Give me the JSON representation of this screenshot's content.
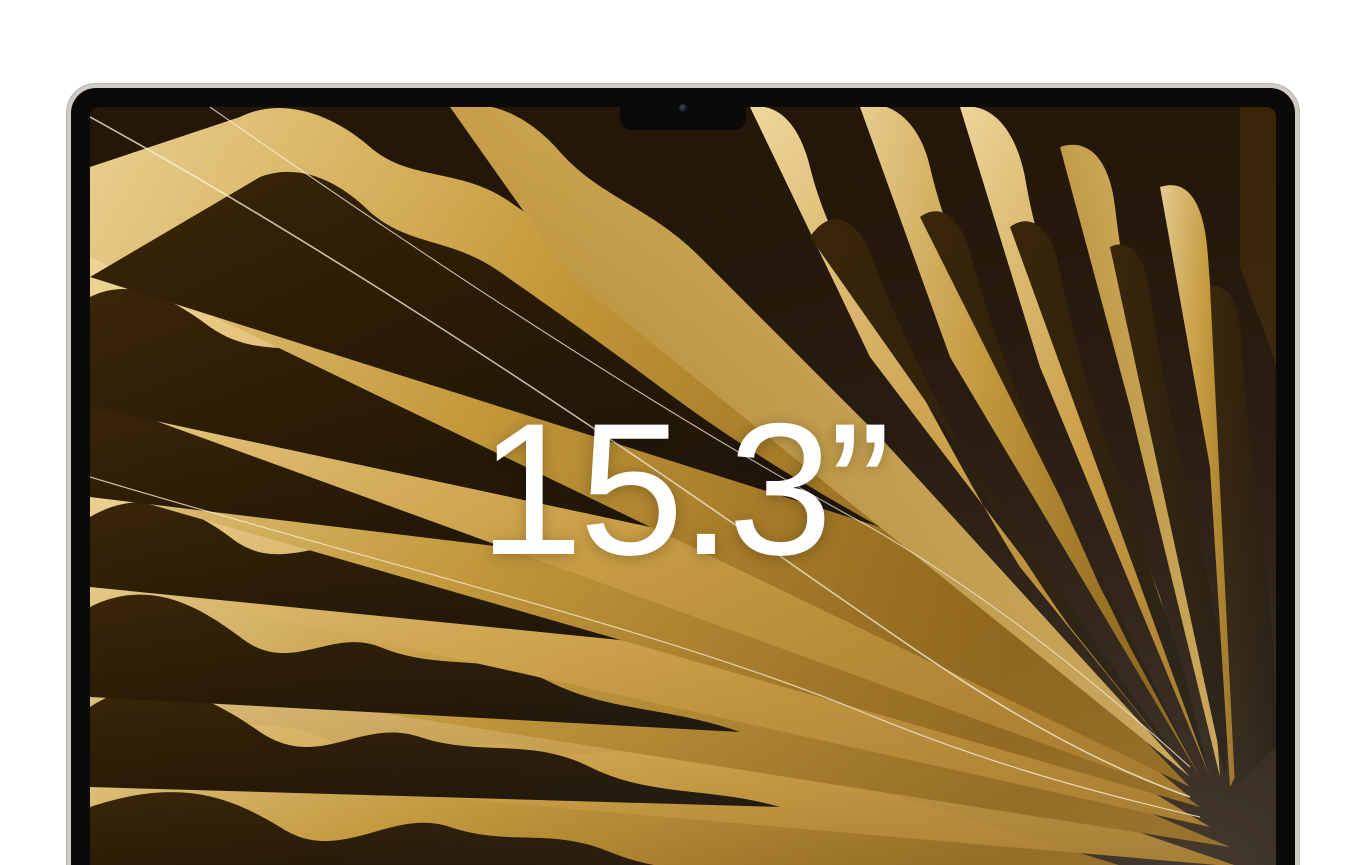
{
  "display": {
    "size_label": "15.3”"
  },
  "colors": {
    "background": "#ffffff",
    "shell": "#cfccc7",
    "bezel": "#0b0a09",
    "wallpaper_dark": "#1e1204",
    "wallpaper_mid": "#a37614",
    "wallpaper_light": "#e8cb86",
    "label": "#ffffff"
  },
  "icons": {
    "camera": "camera-icon"
  }
}
